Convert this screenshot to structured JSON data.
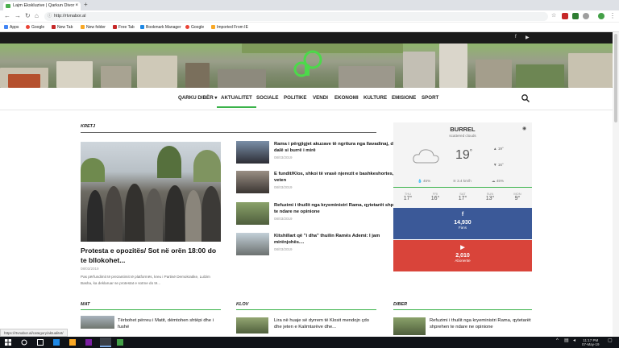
{
  "browser": {
    "tab_title": "Lajm Ekskluzive | Qarkun Divor",
    "url": "http://rtvnabor.al",
    "bookmarks": [
      "Apps",
      "Google",
      "New Tab",
      "New folder",
      "Free Tab",
      "Bookmark Manager",
      "Google",
      "Imported From IE"
    ]
  },
  "menu": {
    "items": [
      "QARKU DIBËR",
      "AKTUALITET",
      "SOCIALE",
      "POLITIKE",
      "VENDI",
      "EKONOMI",
      "KULTURE",
      "EMISIONE",
      "SPORT"
    ],
    "active": "AKTUALITET"
  },
  "sections": {
    "main": "KRETJ",
    "bottom_left": "MAT",
    "bottom_mid": "KLOV",
    "bottom_right": "DIBER"
  },
  "featured": {
    "headline": "Protesta e opozitës/ Sot në orën 18:00 do te bllokohet...",
    "date": "08/03/2019",
    "excerpt": "Pas përfundimit të prezantimit të platformës, kreu i Partisë Demokratike, Lulzim Basha, ka deklaruar se protestat e sotme do të..."
  },
  "side_news": [
    {
      "title": "Rama i përgjigjet akuzave të ngritura nga Ilavadinaj, do të dalë si burrë i mirë",
      "date": "08/03/2019"
    },
    {
      "title": "E fundit/Klos, shkoi të vrasë njerezit e bashkeshortes, vrei veten",
      "date": "08/03/2019"
    },
    {
      "title": "Refuzimi i thuilit nga kryeministri Rama, qytetarët shprehen te ndare ne opinione",
      "date": "08/03/2019"
    },
    {
      "title": "Kitshillart që \"i dha\" thuilin Ramës Ademi: I jam mirënjohës....",
      "date": "08/03/2019"
    }
  ],
  "weather": {
    "city": "BURREL",
    "condition": "scattered clouds",
    "temp": "19",
    "unit": "°",
    "high": "19°",
    "low": "16°",
    "humidity": "45%",
    "wind": "3.4 km/h",
    "clouds": "45%",
    "forecast": [
      {
        "day": "THU",
        "temp": "17°"
      },
      {
        "day": "FRI",
        "temp": "16°"
      },
      {
        "day": "SAT",
        "temp": "17°"
      },
      {
        "day": "SUN",
        "temp": "13°"
      },
      {
        "day": "MON",
        "temp": "9°"
      }
    ]
  },
  "social": {
    "facebook": {
      "count": "14,930",
      "label": "Fans"
    },
    "youtube": {
      "count": "2,010",
      "label": "Abonente"
    }
  },
  "bottom_news": {
    "left": "Tërbohet përreu i Matit, dëmtohen shtëpi dhe i fushë",
    "mid": "Lira në huaje së dyrrem të Klosit mendojn çdo dhe jeten e Kalimtarëve dhe...",
    "right": "Refuzimi i thuilit nga kryeministri Rama, qytetarët shprehen te ndare ne opinione"
  },
  "status_url": "https://rtvnabor.al/category/aktualitet/",
  "taskbar": {
    "time": "11:17 PM",
    "date": "07-May-19"
  }
}
